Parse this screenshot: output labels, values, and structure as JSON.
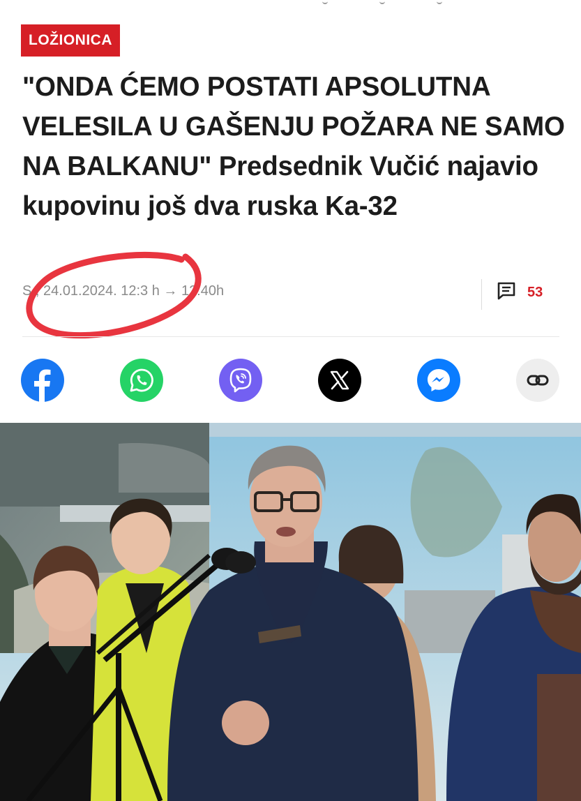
{
  "article": {
    "category": "LOŽIONICA",
    "headline": "\"ONDA ĆEMO POSTATI APSOLUTNA VELESILA U GAŠENJU POŽARA NE SAMO NA BALKANU\" Predsednik Vučić najavio kupovinu još dva ruska Ka-32",
    "date_text": "S  , 24.01.2024. 12:3  h → 12:40h",
    "comments_count": "53"
  },
  "share": {
    "buttons": [
      {
        "icon": "facebook-icon",
        "color": "#1877f2"
      },
      {
        "icon": "whatsapp-icon",
        "color": "#25d366"
      },
      {
        "icon": "viber-icon",
        "color": "#7360f2"
      },
      {
        "icon": "x-icon",
        "color": "#000000"
      },
      {
        "icon": "messenger-icon",
        "color": "#0a7cff"
      },
      {
        "icon": "link-icon",
        "color": "#eeeeee"
      }
    ]
  },
  "colors": {
    "accent_red": "#d61f26",
    "annotation_red": "#e8353f",
    "text_dark": "#1c1c1c",
    "text_muted": "#8a8a8a"
  }
}
